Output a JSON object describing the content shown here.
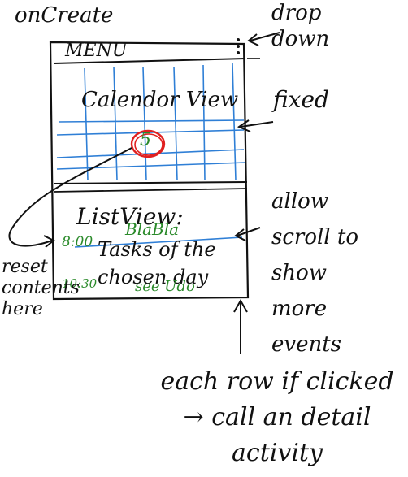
{
  "header_note": "onCreate",
  "phone": {
    "menu_label": "MENU",
    "dropdown_icon": "vertical-dots-icon",
    "calendar_label": "Calendor View",
    "selected_day": "5",
    "list_label": "ListView:",
    "list_tasks_label": "Tasks of the chosen day",
    "rows": [
      {
        "time": "8:00",
        "title": "BlaBla"
      },
      {
        "time": "10:30",
        "title": "see Udo"
      }
    ]
  },
  "annotations": {
    "drop_down": "drop down",
    "fixed": "fixed",
    "allow_scroll": "allow scroll to show more events",
    "reset_contents": "reset contents here",
    "row_click": "each row if clicked → call an detail activity"
  },
  "colors": {
    "ink": "#111111",
    "grid": "#2f7fd6",
    "highlight": "#e02020",
    "entry": "#2a8a2a"
  }
}
